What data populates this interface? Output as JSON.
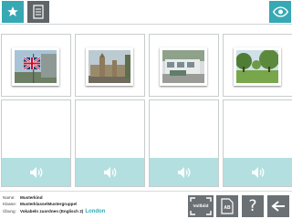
{
  "toolbar": {
    "star_icon": "star-icon",
    "doc_icon": "document-icon",
    "eye_icon": "eye-icon",
    "accent": "#36a9b4"
  },
  "cards": [
    {
      "id": "flag",
      "icon": "union-jack-photo"
    },
    {
      "id": "parliament",
      "icon": "houses-of-parliament-photo"
    },
    {
      "id": "bus",
      "icon": "london-bus-photo"
    },
    {
      "id": "park",
      "icon": "park-photo"
    }
  ],
  "slots": [
    {
      "icon": "speaker-icon"
    },
    {
      "icon": "speaker-icon"
    },
    {
      "icon": "speaker-icon"
    },
    {
      "icon": "speaker-icon"
    }
  ],
  "footer": {
    "name_label": "Name:",
    "name_value": "Musterkind",
    "class_label": "Klasse:",
    "class_value": "Musterklasse\\Mustergruppe\\",
    "exercise_label": "Übung:",
    "exercise_value": "Vokabeln zuordnen (Englisch 2)",
    "topic": "London",
    "fullscreen_label": "Vollbild",
    "ab_label": "AB",
    "help_label": "?"
  }
}
